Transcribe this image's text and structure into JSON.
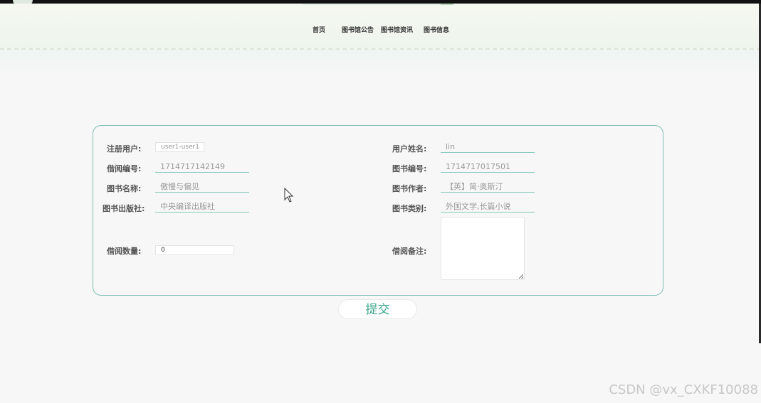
{
  "nav": {
    "items": [
      "首页",
      "图书馆公告",
      "图书馆资讯",
      "图书信息"
    ]
  },
  "form": {
    "left": [
      {
        "label": "注册用户:",
        "value": "user1-user1"
      },
      {
        "label": "借阅编号:",
        "value": "1714717142149"
      },
      {
        "label": "图书名称:",
        "value": "傲慢与偏见"
      },
      {
        "label": "图书出版社:",
        "value": "中央编译出版社"
      },
      {
        "label": "借阅数量:",
        "value": "0"
      }
    ],
    "right": [
      {
        "label": "用户姓名:",
        "value": "lin"
      },
      {
        "label": "图书编号:",
        "value": "1714717017501"
      },
      {
        "label": "图书作者:",
        "value": "【英】简·奥斯汀"
      },
      {
        "label": "图书类别:",
        "value": "外国文学,长篇小说"
      },
      {
        "label": "借阅备注:",
        "value": ""
      }
    ],
    "submit_label": "提交"
  },
  "watermark": "CSDN @vx_CXKF10088",
  "colors": {
    "accent": "#3aa58c",
    "border": "#7fbfb3"
  }
}
